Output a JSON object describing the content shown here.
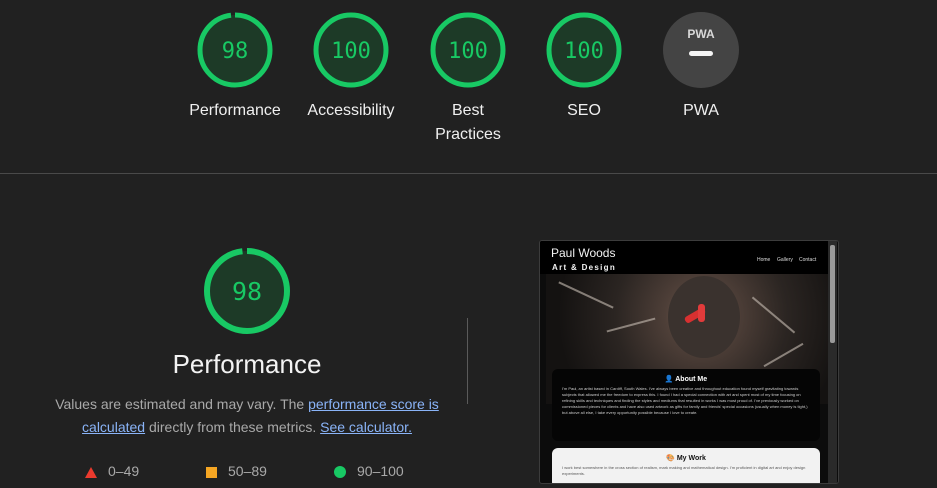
{
  "scores": [
    {
      "label": "Performance",
      "score": "98",
      "value": 0.98,
      "status": "pass"
    },
    {
      "label": "Accessibility",
      "score": "100",
      "value": 1.0,
      "status": "pass"
    },
    {
      "label": "Best Practices",
      "label_line1": "Best",
      "label_line2": "Practices",
      "score": "100",
      "value": 1.0,
      "status": "pass"
    },
    {
      "label": "SEO",
      "score": "100",
      "value": 1.0,
      "status": "pass"
    },
    {
      "label": "PWA",
      "badge": "PWA",
      "status": "na"
    }
  ],
  "performance": {
    "score": "98",
    "value": 0.98,
    "title": "Performance",
    "desc_text1": "Values are estimated and may vary. The ",
    "desc_link1": "performance score is calculated",
    "desc_text2": " directly from these metrics. ",
    "desc_link2": "See calculator."
  },
  "legend": [
    {
      "icon": "triangle-red",
      "range": "0–49"
    },
    {
      "icon": "square-orange",
      "range": "50–89"
    },
    {
      "icon": "circle-green",
      "range": "90–100"
    }
  ],
  "colors": {
    "pass": "#18c964",
    "pass_bg": "#1d3a27",
    "na": "#444444",
    "fail": "#eb3a2e",
    "average": "#f5a623",
    "link": "#8ab4f8"
  },
  "screenshot": {
    "site_name": "Paul Woods",
    "site_subtitle": "Art & Design",
    "nav": [
      "Home",
      "Gallery",
      "Contact"
    ],
    "about_title": "About Me",
    "about_text": "I'm Paul, an artist based in Cardiff, South Wales. I've always been creative and throughout education found myself gravitating towards subjects that allowed me the freedom to express this. I found I had a special connection with art and spent most of my time focusing on refining skills and techniques and finding the styles and mediums that resulted in works I was most proud of. I've previously worked on commissioned pieces for clients and have also used artwork as gifts for family and friends' special occasions (usually when money is tight,) but above all else, I take every opportunity possible because I love to create.",
    "work_title": "My Work",
    "work_text": "I work best somewhere in the cross section of realism, mark making and mathematical design. I'm proficient in digital art and enjoy design experiments."
  }
}
